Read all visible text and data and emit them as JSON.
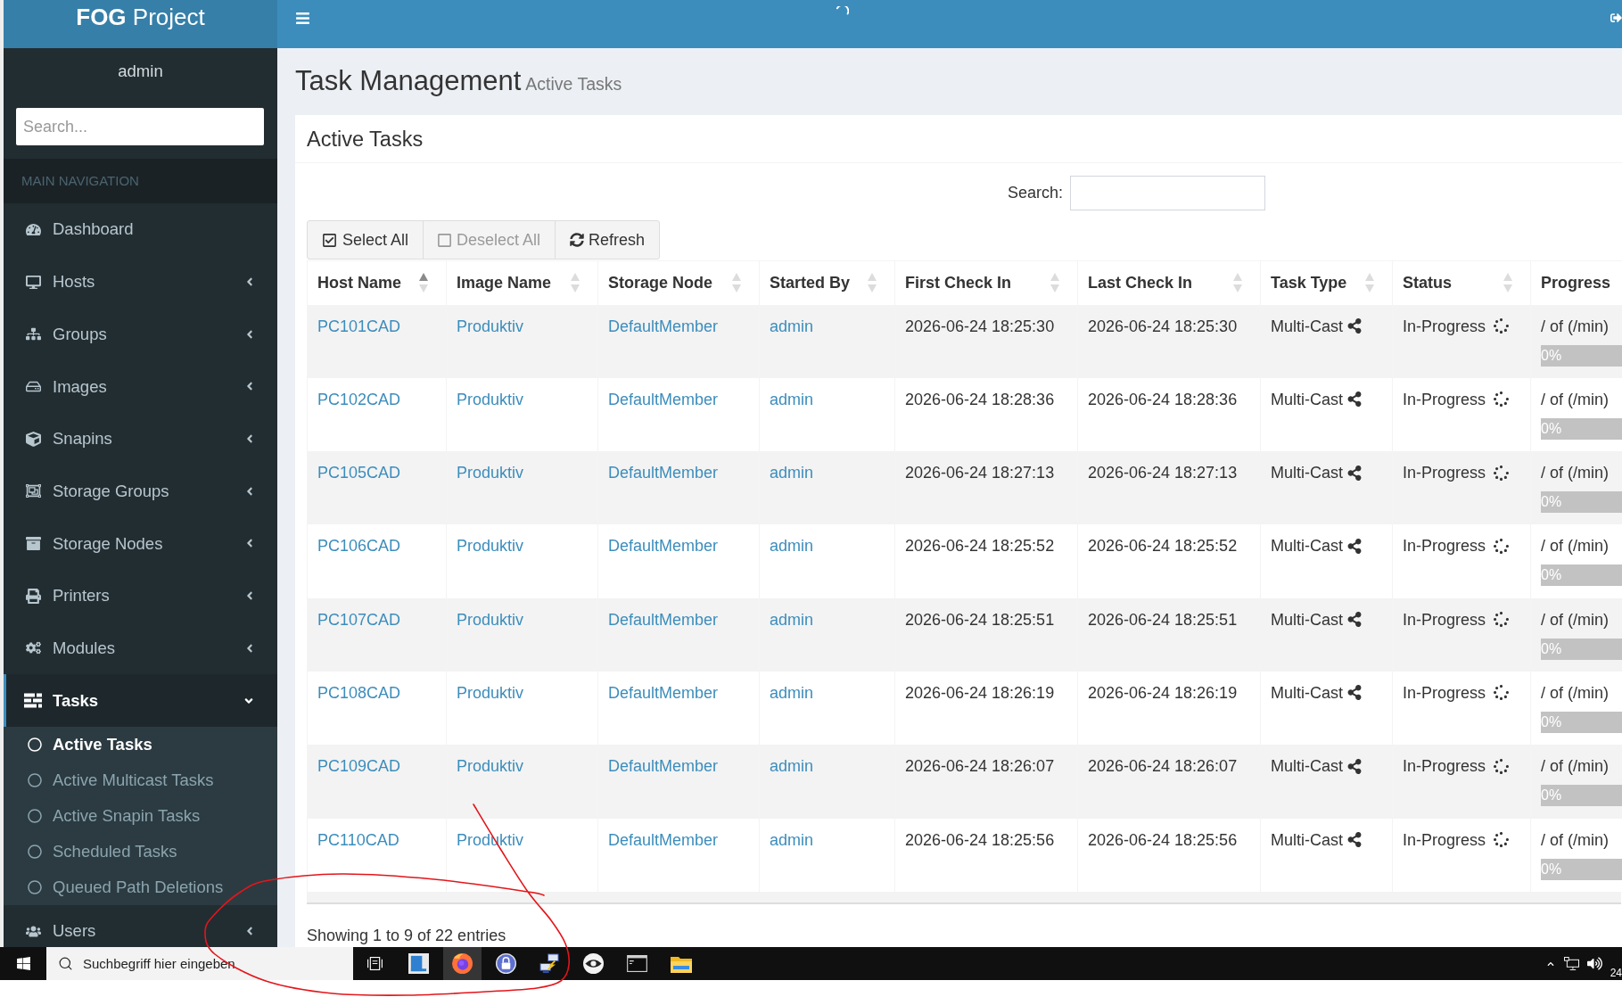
{
  "header": {
    "brand": "**FOG** Project"
  },
  "sidebar": {
    "user": "admin",
    "search": {
      "placeholder": "Search..."
    },
    "section": "MAIN NAVIGATION",
    "items": [
      {
        "label": "Dashboard",
        "has_submenu": false,
        "expanded": false,
        "selected": false
      },
      {
        "label": "Hosts",
        "has_submenu": true,
        "expanded": false,
        "selected": false
      },
      {
        "label": "Groups",
        "has_submenu": true,
        "expanded": false,
        "selected": false
      },
      {
        "label": "Images",
        "has_submenu": true,
        "expanded": false,
        "selected": false
      },
      {
        "label": "Snapins",
        "has_submenu": true,
        "expanded": false,
        "selected": false
      },
      {
        "label": "Storage Groups",
        "has_submenu": true,
        "expanded": false,
        "selected": false
      },
      {
        "label": "Storage Nodes",
        "has_submenu": true,
        "expanded": false,
        "selected": false
      },
      {
        "label": "Printers",
        "has_submenu": true,
        "expanded": false,
        "selected": false
      },
      {
        "label": "Modules",
        "has_submenu": true,
        "expanded": false,
        "selected": false
      },
      {
        "label": "Tasks",
        "has_submenu": true,
        "expanded": true,
        "selected": true,
        "children": [
          {
            "label": "Active Tasks",
            "selected": true
          },
          {
            "label": "Active Multicast Tasks",
            "selected": false
          },
          {
            "label": "Active Snapin Tasks",
            "selected": false
          },
          {
            "label": "Scheduled Tasks",
            "selected": false
          },
          {
            "label": "Queued Path Deletions",
            "selected": false
          }
        ]
      },
      {
        "label": "Users",
        "has_submenu": true,
        "expanded": false,
        "selected": false
      }
    ]
  },
  "page": {
    "title": "Task Management",
    "subtitle": "Active Tasks"
  },
  "panel": {
    "title": "Active Tasks",
    "search": {
      "label": "Search:"
    },
    "buttons": [
      {
        "label": "Select All",
        "kind": "select_all",
        "disabled": false
      },
      {
        "label": "Deselect All",
        "kind": "deselect_all",
        "disabled": true
      },
      {
        "label": "Refresh",
        "kind": "refresh",
        "disabled": false
      }
    ],
    "table": {
      "columns": [
        {
          "label": "Host Name",
          "sortable": true,
          "sorted": true
        },
        {
          "label": "Image Name",
          "sortable": true,
          "sorted": false
        },
        {
          "label": "Storage Node",
          "sortable": true,
          "sorted": false
        },
        {
          "label": "Started By",
          "sortable": true,
          "sorted": false
        },
        {
          "label": "First Check In",
          "sortable": true,
          "sorted": false
        },
        {
          "label": "Last Check In",
          "sortable": true,
          "sorted": false
        },
        {
          "label": "Task Type",
          "sortable": true,
          "sorted": false
        },
        {
          "label": "Status",
          "sortable": true,
          "sorted": false
        },
        {
          "label": "Progress",
          "sortable": false,
          "sorted": false
        }
      ],
      "rows": [
        {
          "host_name": "PC101CAD",
          "image_name": "Produktiv",
          "storage_node": "DefaultMember",
          "started_by": "admin",
          "first_check_in": "2026-06-24 18:25:30",
          "last_check_in": "2026-06-24 18:25:30",
          "task_type": "Multi-Cast",
          "status": "In-Progress",
          "progress": {
            "text": "/ of (/min)",
            "level": 0,
            "label": "0%"
          }
        },
        {
          "host_name": "PC102CAD",
          "image_name": "Produktiv",
          "storage_node": "DefaultMember",
          "started_by": "admin",
          "first_check_in": "2026-06-24 18:28:36",
          "last_check_in": "2026-06-24 18:28:36",
          "task_type": "Multi-Cast",
          "status": "In-Progress",
          "progress": {
            "text": "/ of (/min)",
            "level": 0,
            "label": "0%"
          }
        },
        {
          "host_name": "PC105CAD",
          "image_name": "Produktiv",
          "storage_node": "DefaultMember",
          "started_by": "admin",
          "first_check_in": "2026-06-24 18:27:13",
          "last_check_in": "2026-06-24 18:27:13",
          "task_type": "Multi-Cast",
          "status": "In-Progress",
          "progress": {
            "text": "/ of (/min)",
            "level": 0,
            "label": "0%"
          }
        },
        {
          "host_name": "PC106CAD",
          "image_name": "Produktiv",
          "storage_node": "DefaultMember",
          "started_by": "admin",
          "first_check_in": "2026-06-24 18:25:52",
          "last_check_in": "2026-06-24 18:25:52",
          "task_type": "Multi-Cast",
          "status": "In-Progress",
          "progress": {
            "text": "/ of (/min)",
            "level": 0,
            "label": "0%"
          }
        },
        {
          "host_name": "PC107CAD",
          "image_name": "Produktiv",
          "storage_node": "DefaultMember",
          "started_by": "admin",
          "first_check_in": "2026-06-24 18:25:51",
          "last_check_in": "2026-06-24 18:25:51",
          "task_type": "Multi-Cast",
          "status": "In-Progress",
          "progress": {
            "text": "/ of (/min)",
            "level": 0,
            "label": "0%"
          }
        },
        {
          "host_name": "PC108CAD",
          "image_name": "Produktiv",
          "storage_node": "DefaultMember",
          "started_by": "admin",
          "first_check_in": "2026-06-24 18:26:19",
          "last_check_in": "2026-06-24 18:26:19",
          "task_type": "Multi-Cast",
          "status": "In-Progress",
          "progress": {
            "text": "/ of (/min)",
            "level": 0,
            "label": "0%"
          }
        },
        {
          "host_name": "PC109CAD",
          "image_name": "Produktiv",
          "storage_node": "DefaultMember",
          "started_by": "admin",
          "first_check_in": "2026-06-24 18:26:07",
          "last_check_in": "2026-06-24 18:26:07",
          "task_type": "Multi-Cast",
          "status": "In-Progress",
          "progress": {
            "text": "/ of (/min)",
            "level": 0,
            "label": "0%"
          }
        },
        {
          "host_name": "PC110CAD",
          "image_name": "Produktiv",
          "storage_node": "DefaultMember",
          "started_by": "admin",
          "first_check_in": "2026-06-24 18:25:56",
          "last_check_in": "2026-06-24 18:25:56",
          "task_type": "Multi-Cast",
          "status": "In-Progress",
          "progress": {
            "text": "/ of (/min)",
            "level": 0,
            "label": "0%"
          }
        }
      ]
    },
    "info": "Showing 1 to 9 of 22 entries"
  },
  "taskbar": {
    "search": {
      "placeholder": "Suchbegriff hier eingeben"
    },
    "apps": [
      {
        "active": false
      },
      {
        "active": false
      },
      {
        "active": true
      },
      {
        "active": false
      },
      {
        "active": false
      },
      {
        "active": false
      },
      {
        "active": false
      },
      {
        "active": false
      }
    ],
    "clock": "24"
  }
}
